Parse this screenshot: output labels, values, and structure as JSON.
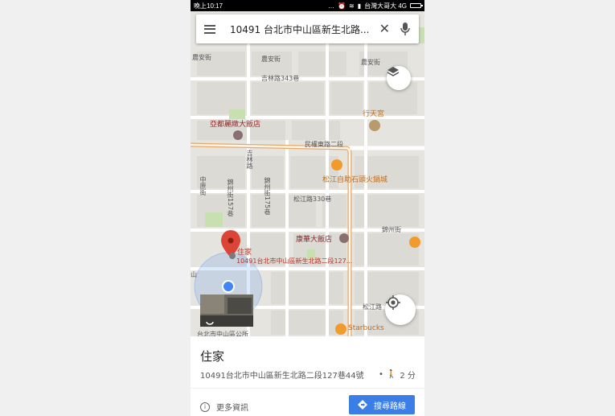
{
  "status_bar": {
    "time": "晚上10:17",
    "carrier": "台灣大哥大 4G",
    "icons": [
      "more-icon",
      "alarm-icon",
      "wifi-icon",
      "signal-icon",
      "battery-icon"
    ]
  },
  "search": {
    "query": "10491 台北市中山區新生北路...",
    "icons": {
      "menu": "menu-icon",
      "clear": "close-icon",
      "voice": "mic-icon"
    }
  },
  "map": {
    "labels": {
      "nongan_w": "農安街",
      "nongan_e": "農安街",
      "jilin343": "吉林路343巷",
      "xingtian": "行天宮",
      "yadu": "亞都麗緻大飯店",
      "minquan": "民權東路二段",
      "songjiang_restaurant": "松江自助石頭火鍋城",
      "jilu_road": "吉林路",
      "zhongyuan": "中原街",
      "jinzhou157": "錦州街157巷",
      "songjiang330": "松江路330巷",
      "jinzhou175": "錦州街175巷",
      "kanghua": "康華大飯店",
      "jinzhou": "錦州街",
      "home_label": "住家",
      "home_address": "10491台北市中山區新生北路二段127...",
      "songjiang_road": "松江路",
      "starbucks": "Starbucks",
      "post_office": "台北市中山區公所",
      "left_edge": "山"
    },
    "colors": {
      "pin": "#db4437",
      "location_dot": "#4285f4",
      "route": "#e8a86a",
      "park": "#c8e0b0"
    }
  },
  "place_card": {
    "title": "住家",
    "address": "10491台北市中山區新生北路二段127巷44號",
    "separator": "•",
    "walk_time": "2 分",
    "more_info": "更多資訊",
    "directions": "搜尋路線"
  },
  "accent_color": "#3b7ee6"
}
